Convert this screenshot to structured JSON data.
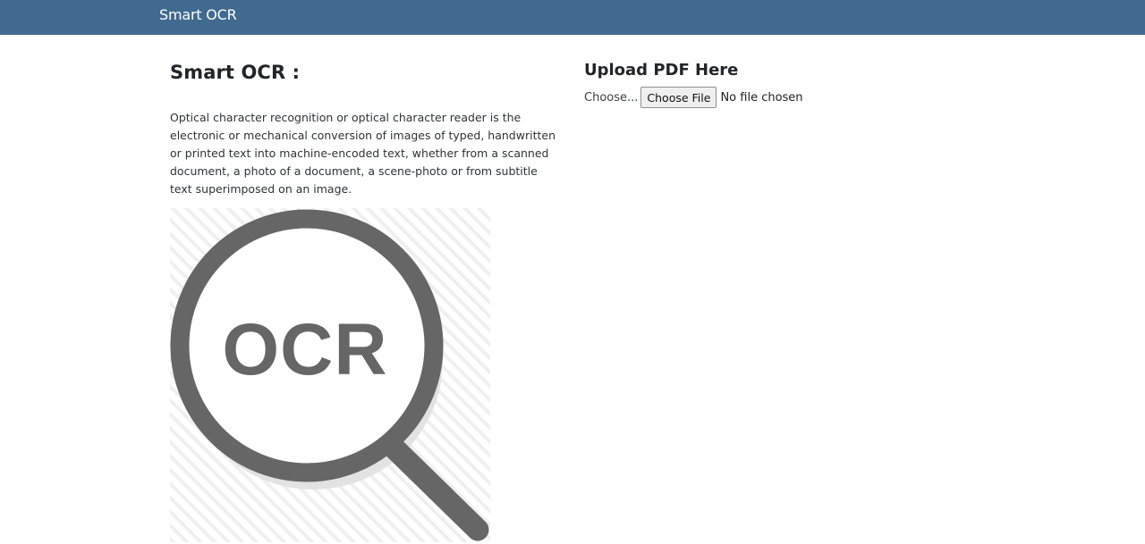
{
  "navbar": {
    "brand": "Smart OCR"
  },
  "intro": {
    "title": "Smart OCR :",
    "description": "Optical character recognition or optical character reader is the electronic or mechanical conversion of images of typed, handwritten or printed text into machine-encoded text, whether from a scanned document, a photo of a document, a scene-photo or from subtitle text superimposed on an image.",
    "image_text": "OCR",
    "image_icon": "magnifying-glass-icon"
  },
  "upload": {
    "title": "Upload PDF Here",
    "label": "Choose...",
    "button_label": "Choose File",
    "status": "No file chosen"
  },
  "colors": {
    "navbar": "#416a90",
    "text": "#212529",
    "icon_gray": "#666666"
  }
}
